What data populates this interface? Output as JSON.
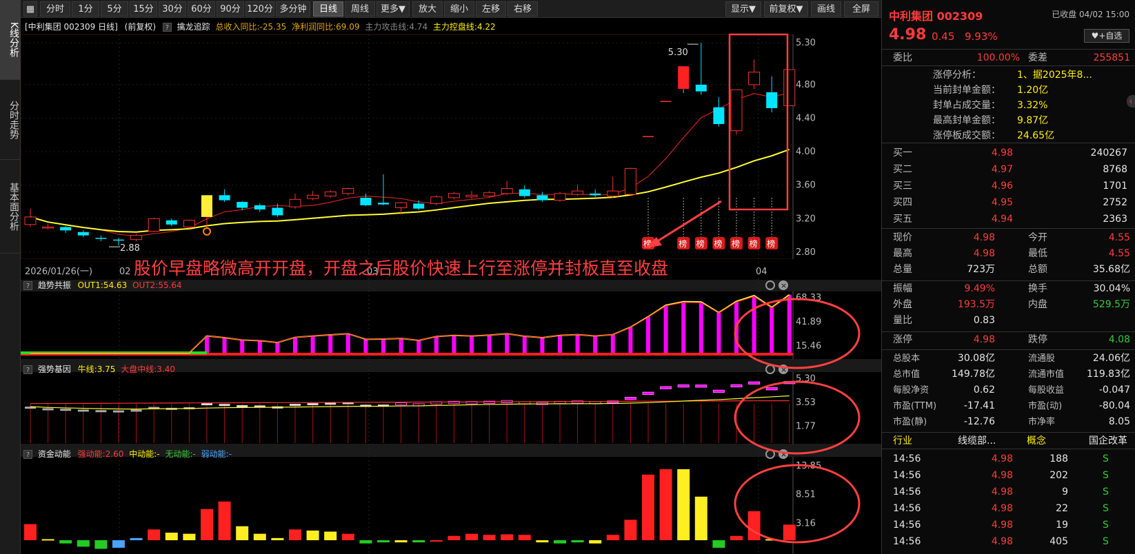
{
  "left_tabs": [
    "K线分析",
    "分时走势",
    "基本面分析"
  ],
  "toolbar": {
    "left": [
      "分时",
      "1分",
      "5分",
      "15分",
      "30分",
      "60分",
      "90分",
      "120分",
      "多分钟",
      "日线",
      "周线",
      "更多▼",
      "放大",
      "缩小",
      "左移",
      "右移"
    ],
    "active": "日线",
    "right": [
      "显示▼",
      "前复权▼",
      "画线",
      "全屏"
    ]
  },
  "main_header": {
    "title": "[中利集团 002309 日线]",
    "adj": "(前复权)",
    "indicator": "擒龙追踪",
    "rev_label": "总收入同比:-25.35",
    "profit_label": "净利润同比:69.09",
    "attack_label": "主力攻击线:4.74",
    "control_label": "主力控盘线:4.22"
  },
  "main_chart": {
    "y_ticks": [
      "5.30",
      "4.80",
      "4.40",
      "4.00",
      "3.60",
      "3.20",
      "2.80"
    ],
    "x_labels": [
      "2026/01/26(一)",
      "02",
      "03",
      "04"
    ],
    "high_label": "5.30",
    "low_label": "2.88",
    "annotation": "股价早盘略微高开开盘，开盘之后股价快速上行至涨停并封板直至收盘",
    "bang_label": "榜"
  },
  "chart_data": {
    "type": "candlestick",
    "candles": [
      {
        "o": 3.13,
        "c": 3.22,
        "h": 3.32,
        "l": 3.1
      },
      {
        "o": 3.1,
        "c": 3.1,
        "h": 3.14,
        "l": 3.07
      },
      {
        "o": 3.1,
        "c": 3.06,
        "h": 3.11,
        "l": 3.03
      },
      {
        "o": 3.04,
        "c": 3.0,
        "h": 3.06,
        "l": 2.98
      },
      {
        "o": 2.97,
        "c": 2.96,
        "h": 3.0,
        "l": 2.93
      },
      {
        "o": 2.95,
        "c": 2.94,
        "h": 2.97,
        "l": 2.88
      },
      {
        "o": 2.95,
        "c": 3.0,
        "h": 3.02,
        "l": 2.93
      },
      {
        "o": 3.05,
        "c": 3.2,
        "h": 3.21,
        "l": 3.04
      },
      {
        "o": 3.18,
        "c": 3.13,
        "h": 3.2,
        "l": 3.11
      },
      {
        "o": 3.1,
        "c": 3.18,
        "h": 3.19,
        "l": 3.08
      },
      {
        "o": 3.22,
        "c": 3.48,
        "h": 3.48,
        "l": 3.08
      },
      {
        "o": 3.48,
        "c": 3.42,
        "h": 3.55,
        "l": 3.4
      },
      {
        "o": 3.4,
        "c": 3.33,
        "h": 3.41,
        "l": 3.3
      },
      {
        "o": 3.36,
        "c": 3.31,
        "h": 3.38,
        "l": 3.28
      },
      {
        "o": 3.33,
        "c": 3.24,
        "h": 3.38,
        "l": 3.22
      },
      {
        "o": 3.34,
        "c": 3.43,
        "h": 3.5,
        "l": 3.32
      },
      {
        "o": 3.44,
        "c": 3.48,
        "h": 3.53,
        "l": 3.42
      },
      {
        "o": 3.47,
        "c": 3.52,
        "h": 3.54,
        "l": 3.45
      },
      {
        "o": 3.5,
        "c": 3.56,
        "h": 3.57,
        "l": 3.48
      },
      {
        "o": 3.45,
        "c": 3.36,
        "h": 3.5,
        "l": 3.35
      },
      {
        "o": 3.39,
        "c": 3.37,
        "h": 3.73,
        "l": 3.36
      },
      {
        "o": 3.33,
        "c": 3.39,
        "h": 3.4,
        "l": 3.25
      },
      {
        "o": 3.38,
        "c": 3.32,
        "h": 3.42,
        "l": 3.3
      },
      {
        "o": 3.38,
        "c": 3.46,
        "h": 3.48,
        "l": 3.36
      },
      {
        "o": 3.45,
        "c": 3.5,
        "h": 3.52,
        "l": 3.43
      },
      {
        "o": 3.46,
        "c": 3.48,
        "h": 3.53,
        "l": 3.44
      },
      {
        "o": 3.47,
        "c": 3.51,
        "h": 3.53,
        "l": 3.45
      },
      {
        "o": 3.5,
        "c": 3.56,
        "h": 3.65,
        "l": 3.48
      },
      {
        "o": 3.55,
        "c": 3.47,
        "h": 3.6,
        "l": 3.45
      },
      {
        "o": 3.48,
        "c": 3.42,
        "h": 3.52,
        "l": 3.4
      },
      {
        "o": 3.42,
        "c": 3.5,
        "h": 3.52,
        "l": 3.4
      },
      {
        "o": 3.49,
        "c": 3.53,
        "h": 3.61,
        "l": 3.47
      },
      {
        "o": 3.5,
        "c": 3.48,
        "h": 3.55,
        "l": 3.46
      },
      {
        "o": 3.47,
        "c": 3.53,
        "h": 3.7,
        "l": 3.45
      },
      {
        "o": 3.49,
        "c": 3.8,
        "h": 3.81,
        "l": 3.48
      },
      {
        "o": 4.18,
        "c": 4.18,
        "h": 4.18,
        "l": 4.18
      },
      {
        "o": 4.6,
        "c": 4.6,
        "h": 4.6,
        "l": 4.6
      },
      {
        "o": 4.98,
        "c": 4.73,
        "h": 5.02,
        "l": 4.7
      },
      {
        "o": 4.8,
        "c": 4.72,
        "h": 5.3,
        "l": 4.68
      },
      {
        "o": 4.53,
        "c": 4.33,
        "h": 4.65,
        "l": 4.3
      },
      {
        "o": 4.25,
        "c": 4.74,
        "h": 4.74,
        "l": 4.2
      },
      {
        "o": 4.8,
        "c": 4.95,
        "h": 5.1,
        "l": 4.75
      },
      {
        "o": 4.71,
        "c": 4.52,
        "h": 4.9,
        "l": 4.47
      },
      {
        "o": 4.55,
        "c": 4.98,
        "h": 4.98,
        "l": 4.55
      }
    ],
    "y_range": [
      2.75,
      5.4
    ]
  },
  "sub1": {
    "name": "趋势共振",
    "out1": "OUT1:54.63",
    "out2": "OUT2:55.64",
    "y_ticks": [
      "68.33",
      "41.89",
      "15.46"
    ]
  },
  "sub2": {
    "name": "强势基因",
    "bull": "牛线:3.75",
    "bigline": "大盘中线:3.40",
    "y_ticks": [
      "5.30",
      "3.53",
      "1.77"
    ]
  },
  "sub3": {
    "name": "资金动能",
    "strong": "强动能:2.60",
    "mid": "中动能:-",
    "none": "无动能:-",
    "weak": "弱动能:-",
    "y_ticks": [
      "13.85",
      "8.51",
      "3.16"
    ]
  },
  "panel": {
    "name": "中利集团 002309",
    "status": "已收盘 04/02 15:00",
    "price": "4.98",
    "change": "0.45",
    "pct": "9.93%",
    "add_btn": "+自选",
    "wb_label": "委比",
    "wb": "100.00%",
    "wc_label": "委差",
    "wc": "255851",
    "zt": [
      {
        "k": "涨停分析：",
        "v": "1、据2025年8..."
      },
      {
        "k": "当前封单金额：",
        "v": "1.20亿"
      },
      {
        "k": "封单占成交量：",
        "v": "3.32%"
      },
      {
        "k": "最高封单金额：",
        "v": "9.87亿"
      },
      {
        "k": "涨停板成交额：",
        "v": "24.65亿"
      }
    ],
    "buys": [
      {
        "k": "买一",
        "p": "4.98",
        "v": "240267"
      },
      {
        "k": "买二",
        "p": "4.97",
        "v": "8768"
      },
      {
        "k": "买三",
        "p": "4.96",
        "v": "1701"
      },
      {
        "k": "买四",
        "p": "4.95",
        "v": "2752"
      },
      {
        "k": "买五",
        "p": "4.94",
        "v": "2363"
      }
    ],
    "stats": [
      [
        {
          "k": "现价",
          "v": "4.98",
          "c": "red"
        },
        {
          "k": "今开",
          "v": "4.55",
          "c": "red"
        }
      ],
      [
        {
          "k": "最高",
          "v": "4.98",
          "c": "red"
        },
        {
          "k": "最低",
          "v": "4.55",
          "c": "red"
        }
      ],
      [
        {
          "k": "总量",
          "v": "723万",
          "c": "white"
        },
        {
          "k": "总额",
          "v": "35.68亿",
          "c": "white"
        }
      ]
    ],
    "stats2": [
      [
        {
          "k": "振幅",
          "v": "9.49%",
          "c": "red"
        },
        {
          "k": "换手",
          "v": "30.04%",
          "c": "white"
        }
      ],
      [
        {
          "k": "外盘",
          "v": "193.5万",
          "c": "red"
        },
        {
          "k": "内盘",
          "v": "529.5万",
          "c": "green"
        }
      ],
      [
        {
          "k": "量比",
          "v": "0.83",
          "c": "white"
        }
      ]
    ],
    "stats3": [
      [
        {
          "k": "涨停",
          "v": "4.98",
          "c": "red"
        },
        {
          "k": "跌停",
          "v": "4.08",
          "c": "green"
        }
      ]
    ],
    "fund": [
      [
        {
          "k": "总股本",
          "v": "30.08亿"
        },
        {
          "k": "流通股",
          "v": "24.06亿"
        }
      ],
      [
        {
          "k": "总市值",
          "v": "149.78亿"
        },
        {
          "k": "流通市值",
          "v": "119.83亿"
        }
      ],
      [
        {
          "k": "每股净资",
          "v": "0.62"
        },
        {
          "k": "每股收益",
          "v": "-0.047"
        }
      ],
      [
        {
          "k": "市盈(TTM)",
          "v": "-17.41"
        },
        {
          "k": "市盈(动)",
          "v": "-80.04"
        }
      ],
      [
        {
          "k": "市盈(静)",
          "v": "-12.76"
        },
        {
          "k": "市净率",
          "v": "8.05"
        }
      ]
    ],
    "industry_label": "行业",
    "industry": "线缆部...",
    "concept_label": "概念",
    "concept": "国企改革",
    "ticks": [
      {
        "t": "14:56",
        "p": "4.98",
        "v": "188",
        "s": "S"
      },
      {
        "t": "14:56",
        "p": "4.98",
        "v": "202",
        "s": "S"
      },
      {
        "t": "14:56",
        "p": "4.98",
        "v": "9",
        "s": "S"
      },
      {
        "t": "14:56",
        "p": "4.98",
        "v": "22",
        "s": "S"
      },
      {
        "t": "14:56",
        "p": "4.98",
        "v": "19",
        "s": "S"
      },
      {
        "t": "14:56",
        "p": "4.98",
        "v": "405",
        "s": "S"
      }
    ]
  },
  "colors": {
    "up": "#ff3030",
    "down": "#00e5ff",
    "ma_yellow": "#ffff33",
    "magenta": "#ff00ff",
    "circle": "#ff4040"
  }
}
